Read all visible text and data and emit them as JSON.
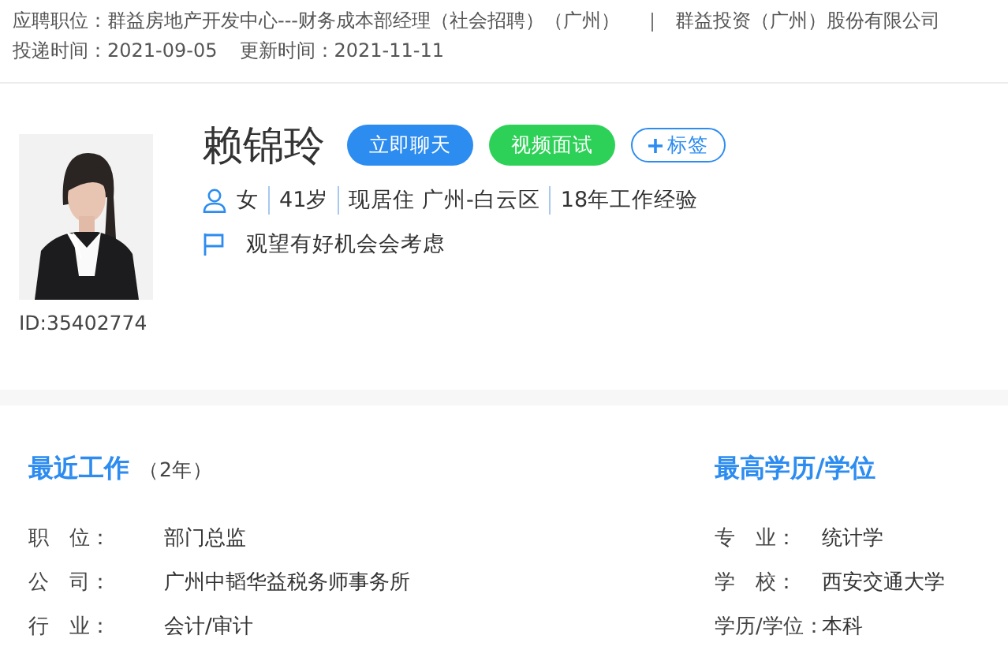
{
  "application": {
    "position_label": "应聘职位：",
    "position": "群益房地产开发中心---财务成本部经理（社会招聘）（广州）",
    "company": "群益投资（广州）股份有限公司",
    "submitted_label": "投递时间：",
    "submitted": "2021-09-05",
    "updated_label": "更新时间：",
    "updated": "2021-11-11"
  },
  "profile": {
    "id": "ID:35402774",
    "name": "赖锦玲",
    "buttons": [
      {
        "label": "立即聊天",
        "kind": "chat"
      },
      {
        "label": "视频面试",
        "kind": "video"
      },
      {
        "label": "标签",
        "kind": "tag"
      }
    ],
    "facts": [
      "女",
      "41岁",
      "现居住 广州-白云区",
      "18年工作经验"
    ],
    "status": "观望有好机会会考虑"
  },
  "recent_work": {
    "title": "最近工作",
    "duration": "（2年）",
    "fields": [
      {
        "label": "职　位：",
        "value": "部门总监"
      },
      {
        "label": "公　司：",
        "value": "广州中韬华益税务师事务所"
      },
      {
        "label": "行　业：",
        "value": "会计/审计"
      }
    ]
  },
  "education": {
    "title": "最高学历/学位",
    "fields": [
      {
        "label": "专　业：",
        "value": "统计学"
      },
      {
        "label": "学　校：",
        "value": "西安交通大学"
      },
      {
        "label": "学历/学位：",
        "value": "本科"
      }
    ]
  }
}
